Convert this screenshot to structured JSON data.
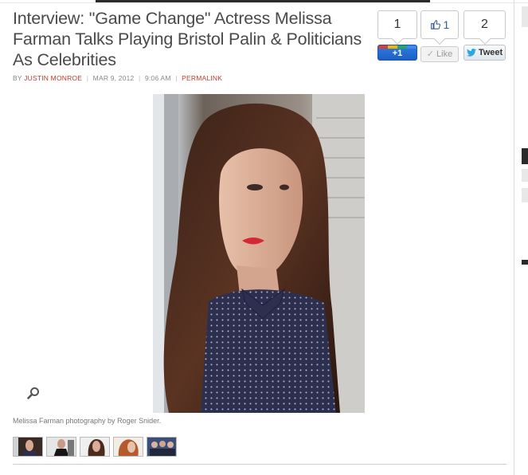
{
  "article": {
    "title": "Interview: \"Game Change\" Actress Melissa Farman Talks Playing Bristol Palin & Politicians As Celebrities",
    "byline": {
      "prefix": "BY",
      "author": "JUSTIN MONROE",
      "date": "MAR 9, 2012",
      "time": "9:06 AM",
      "permalink": "PERMALINK"
    },
    "photo_caption": "Melissa Farman photography by Roger Snider."
  },
  "social": {
    "gplus_count": "1",
    "gplus_label": "+1",
    "fb_count": "1",
    "fb_label": "Like",
    "twitter_count": "2",
    "twitter_label": "Tweet"
  },
  "colors": {
    "accent_red": "#c0392b",
    "title_gray": "#4a4a4a",
    "gplus_blue": "#1d5fc4",
    "facebook_blue": "#3b5998"
  },
  "icons": [
    "zoom-icon",
    "thumbs-up-icon",
    "twitter-bird-icon"
  ],
  "gallery": {
    "thumbnail_count": 5
  }
}
